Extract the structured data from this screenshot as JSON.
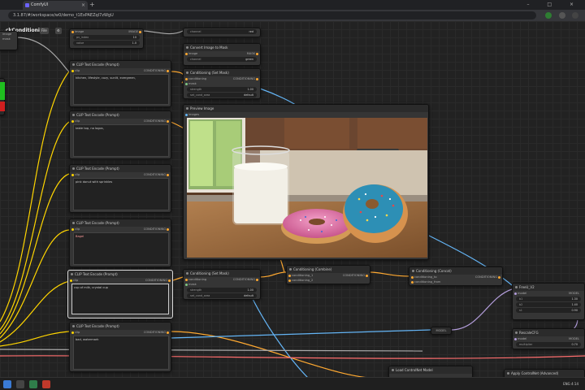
{
  "browser": {
    "tab_title": "ComfyUI",
    "url": "3.1.87/#/workspace/w0/demo_t1ExPAEZqI7zWgU",
    "tab_close": "×",
    "new_tab": "+",
    "window_controls": "– □ ×"
  },
  "comfy": {
    "workflow_title": "...ckConditioning",
    "file_button": "File",
    "menu_button": "⚙"
  },
  "nodes": {
    "clip_1": {
      "title": "CLIP Text Encode (Prompt)",
      "in": "clip",
      "out": "CONDITIONING",
      "text": "kitchen, lifestyle, cozy, sunlit, evergreen,"
    },
    "clip_2": {
      "title": "CLIP Text Encode (Prompt)",
      "in": "clip",
      "out": "CONDITIONING",
      "text": "table top, no logos,"
    },
    "clip_3": {
      "title": "CLIP Text Encode (Prompt)",
      "in": "clip",
      "out": "CONDITIONING",
      "text": "pink donut with sprinkles"
    },
    "clip_4": {
      "title": "CLIP Text Encode (Prompt)",
      "in": "clip",
      "out": "CONDITIONING",
      "text": "Bagel"
    },
    "clip_5": {
      "title": "CLIP Text Encode (Prompt)",
      "in": "clip",
      "out": "CONDITIONING",
      "text": "cup of milk, crystal cup"
    },
    "clip_6": {
      "title": "CLIP Text Encode (Prompt)",
      "in": "clip",
      "out": "CONDITIONING",
      "text": "bad, watermark"
    },
    "preview": {
      "title": "Preview Image",
      "in": "images"
    },
    "set_mask_top": {
      "title": "Conditioning (Set Mask)",
      "in1": "conditioning",
      "in2": "mask",
      "out": "CONDITIONING",
      "w1k": "strength",
      "w1v": "1.00",
      "w2k": "set_cond_area",
      "w2v": "default"
    },
    "set_mask_bottom": {
      "title": "Conditioning (Set Mask)",
      "in1": "conditioning",
      "in2": "mask",
      "out": "CONDITIONING",
      "w1k": "strength",
      "w1v": "1.00",
      "w2k": "set_cond_area",
      "w2v": "default"
    },
    "combine": {
      "title": "Conditioning (Combine)",
      "in1": "conditioning_1",
      "in2": "conditioning_2",
      "out": "CONDITIONING"
    },
    "concat": {
      "title": "Conditioning (Concat)",
      "in1": "conditioning_to",
      "in2": "conditioning_from",
      "out": "CONDITIONING"
    },
    "convert_mask": {
      "title": "Convert Image to Mask",
      "in": "image",
      "out": "MASK",
      "wk": "channel",
      "wv": "green"
    },
    "top_misc": {
      "wk": "channel",
      "wv": "red"
    },
    "freeu": {
      "title": "FreeU_V2",
      "in": "model",
      "out": "MODEL",
      "w": [
        [
          "b1",
          "1.30"
        ],
        [
          "b2",
          "1.40"
        ],
        [
          "s1",
          "0.90"
        ],
        [
          "s2",
          "0.20"
        ]
      ]
    },
    "rescale": {
      "title": "RescaleCFG",
      "in": "model",
      "out": "MODEL",
      "wk": "multiplier",
      "wv": "0.70"
    },
    "controlnet_loader": {
      "title": "Load ControlNet Model",
      "out": "CONTROL_NET"
    },
    "apply_controlnet": {
      "title": "Apply ControlNet (Advanced)"
    },
    "left_node": {
      "label1": "image",
      "label2": "mask",
      "w1": "image",
      "w2": "mask"
    },
    "small_top": {
      "in": "image",
      "out": "IMAGE",
      "k1": "pv_index",
      "v1": "10",
      "k2": "value",
      "v2": "1.0"
    },
    "model_label": "MODEL"
  },
  "taskbar": {
    "time": "4:14",
    "lang": "ENG"
  },
  "colors": {
    "link_clip": "#ffd500",
    "link_cond": "#ffa931",
    "link_model": "#b39ddb",
    "link_image": "#64b5f6",
    "link_red": "#ff6e6e"
  }
}
